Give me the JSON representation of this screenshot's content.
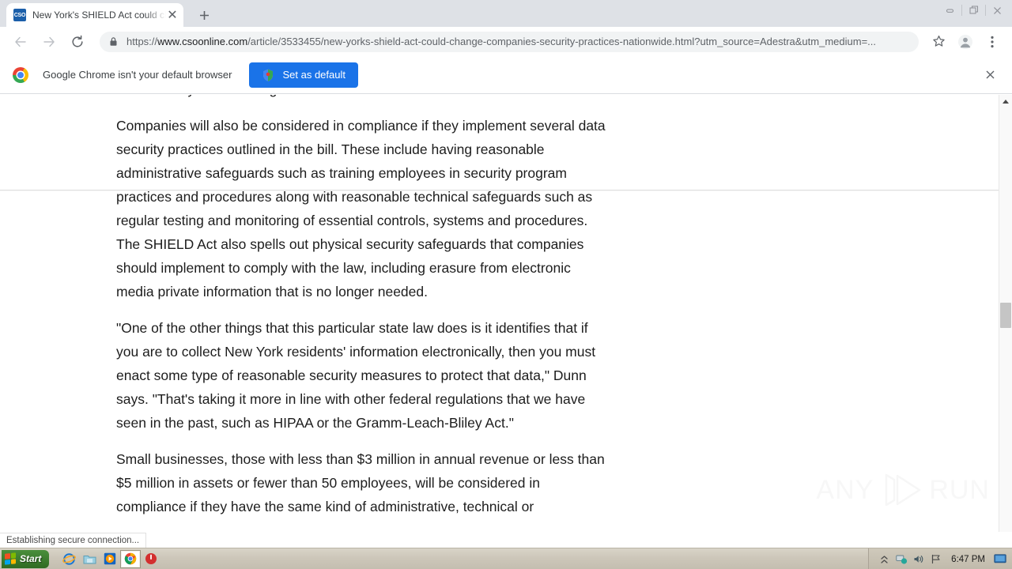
{
  "window": {
    "minimize_label": "Minimize",
    "restore_label": "Restore",
    "close_label": "Close"
  },
  "tabstrip": {
    "tab": {
      "favicon_text": "CSO",
      "title": "New York's SHIELD Act could change",
      "close_label": "✕"
    },
    "new_tab_label": "+"
  },
  "toolbar": {
    "back_label": "←",
    "forward_label": "→",
    "reload_label": "↻",
    "url_scheme": "https://",
    "url_host": "www.csoonline.com",
    "url_path": "/article/3533455/new-yorks-shield-act-could-change-companies-security-practices-nationwide.html?utm_source=Adestra&utm_medium=...",
    "bookmark_label": "☆",
    "profile_label": "Profile",
    "menu_label": "⋮"
  },
  "infobar": {
    "message": "Google Chrome isn't your default browser",
    "set_default_label": "Set as default",
    "close_label": "✕",
    "accent_color": "#1a73e8"
  },
  "page": {
    "paragraphs": [
      "data security laws and regulations.",
      "Companies will also be considered in compliance if they implement several data security practices outlined in the bill. These include having reasonable administrative safeguards such as training employees in security program practices and procedures along with reasonable technical safeguards such as regular testing and monitoring of essential controls, systems and procedures. The SHIELD Act also spells out physical security safeguards that companies should implement to comply with the law, including erasure from electronic media private information that is no longer needed.",
      "\"One of the other things that this particular state law does is it identifies that if you are to collect New York residents' information electronically, then you must enact some type of reasonable security measures to protect that data,\" Dunn says. \"That's taking it more in line with other federal regulations that we have seen in the past, such as HIPAA or the Gramm-Leach-Bliley Act.\"",
      "Small businesses, those with less than $3 million in annual revenue or less than $5 million in assets or fewer than 50 employees, will be considered in compliance if they have the same kind of administrative, technical or"
    ],
    "watermark_left": "ANY",
    "watermark_right": "RUN"
  },
  "status": {
    "message": "Establishing secure connection..."
  },
  "taskbar": {
    "start_label": "Start",
    "quicklaunch": [
      "internet-explorer-icon",
      "folder-icon",
      "media-player-icon",
      "chrome-icon",
      "power-icon"
    ],
    "tray": [
      "show-hidden-icons",
      "network-icon",
      "volume-icon",
      "flag-icon"
    ],
    "clock": "6:47 PM"
  }
}
